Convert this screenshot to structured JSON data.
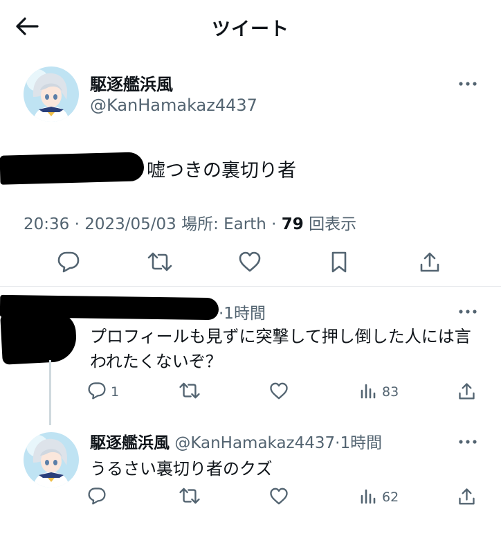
{
  "header": {
    "title": "ツイート",
    "back_icon": "arrow-left-icon"
  },
  "colors": {
    "text": "#0f1419",
    "secondary": "#536471",
    "divider": "#e6e9ec",
    "thread_line": "#cfd9de",
    "background": "#ffffff"
  },
  "main_tweet": {
    "display_name": "駆逐艦浜風",
    "handle": "@KanHamakaz4437",
    "text": "嘘つきの裏切り者",
    "timestamp": "20:36 · 2023/05/03 場所: Earth · ",
    "views_count": "79",
    "views_label": " 回表示",
    "actions": [
      "reply-icon",
      "retweet-icon",
      "like-icon",
      "bookmark-icon",
      "share-icon"
    ]
  },
  "replies": [
    {
      "time": "·1時間",
      "text": "プロフィールも見ずに突撃して押し倒した人には言われたくないぞ？",
      "reply_count": "1",
      "views": "83"
    },
    {
      "display_name": "駆逐艦浜風",
      "handle": "@KanHamakaz4437",
      "time": "·1時間",
      "text": "うるさい裏切り者のクズ",
      "reply_count": "",
      "views": "62"
    }
  ]
}
